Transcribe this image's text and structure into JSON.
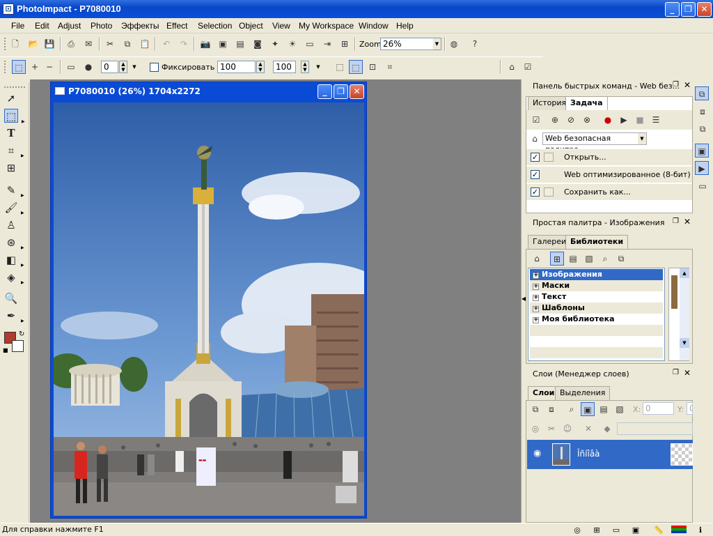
{
  "app": {
    "title": "PhotoImpact - P7080010"
  },
  "menu": [
    "File",
    "Edit",
    "Adjust",
    "Photo",
    "Эффекты",
    "Effect",
    "Selection",
    "Object",
    "View",
    "My Workspace",
    "Window",
    "Help"
  ],
  "toolbar": {
    "zoom_label": "Zoom",
    "zoom_value": "26%"
  },
  "attrbar": {
    "value1": "0",
    "fix_label": "Фиксировать",
    "value2": "100",
    "value3": "100"
  },
  "document": {
    "title": "P7080010 (26%) 1704x2272"
  },
  "quick_panel": {
    "title": "Панель быстрых команд - Web без...",
    "tabs": [
      "История",
      "Задача"
    ],
    "palette_select": "Web безопасная палитра",
    "items": [
      "Открыть...",
      "Web оптимизированное (8-бит)",
      "Сохранить как..."
    ]
  },
  "palette_panel": {
    "title": "Простая палитра - Изображения",
    "tabs": [
      "Галереи",
      "Библиотеки"
    ],
    "tree": [
      "Изображения",
      "Маски",
      "Текст",
      "Шаблоны",
      "Моя библиотека"
    ]
  },
  "layers_panel": {
    "title": "Слои (Менеджер слоев)",
    "tabs": [
      "Слои",
      "Выделения"
    ],
    "x_label": "X:",
    "x_value": "0",
    "y_label": "Y:",
    "y_value": "0",
    "layer_name": "Îñíîâà"
  },
  "status": {
    "text": "Для справки нажмите F1"
  },
  "colors": {
    "titlebar": "#0a47c9",
    "workspace": "#808080",
    "foreground": "#b23a2e",
    "background_color": "#ffffff",
    "selection": "#3169c6"
  }
}
